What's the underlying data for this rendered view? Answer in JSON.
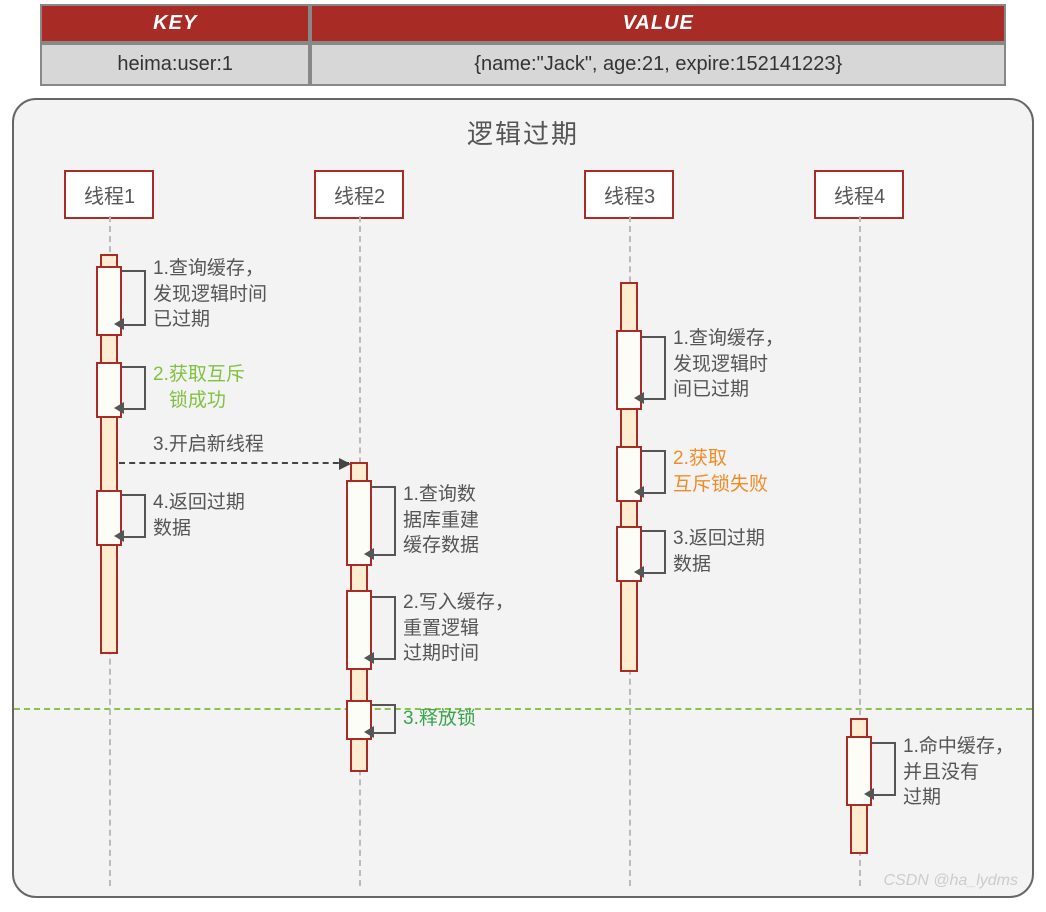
{
  "table": {
    "headers": {
      "key": "KEY",
      "value": "VALUE"
    },
    "row": {
      "key": "heima:user:1",
      "value": "{name:\"Jack\", age:21, expire:152141223}"
    }
  },
  "diagram": {
    "title": "逻辑过期",
    "threads": {
      "t1": "线程1",
      "t2": "线程2",
      "t3": "线程3",
      "t4": "线程4"
    },
    "t1": {
      "s1": "1.查询缓存，\n发现逻辑时间\n已过期",
      "s2": "2.获取互斥\n   锁成功",
      "s3": "3.开启新线程",
      "s4": "4.返回过期\n数据"
    },
    "t2": {
      "s1": "1.查询数\n据库重建\n缓存数据",
      "s2": "2.写入缓存，\n重置逻辑\n过期时间",
      "s3": "3.释放锁"
    },
    "t3": {
      "s1": "1.查询缓存，\n发现逻辑时\n间已过期",
      "s2": "2.获取\n互斥锁失败",
      "s3": "3.返回过期\n数据"
    },
    "t4": {
      "s1": "1.命中缓存，\n并且没有\n过期"
    },
    "watermark": "CSDN @ha_lydms"
  }
}
